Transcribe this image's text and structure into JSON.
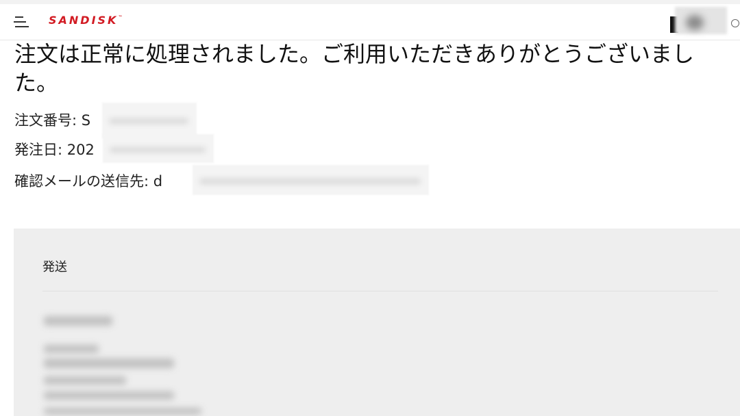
{
  "header": {
    "brand": "SANDISK",
    "brand_tm": "™",
    "accent_color": "#d21b23",
    "icons": [
      "menu-icon",
      "search-icon"
    ]
  },
  "confirmation": {
    "title": "注文は正常に処理されました。ご利用いただきありがとうございました。",
    "order_number_label": "注文番号: ",
    "order_number_value": "S",
    "order_date_label": "発注日: ",
    "order_date_value": "202",
    "email_label": "確認メールの送信先: ",
    "email_value": "d"
  },
  "shipping": {
    "title": "発送"
  }
}
